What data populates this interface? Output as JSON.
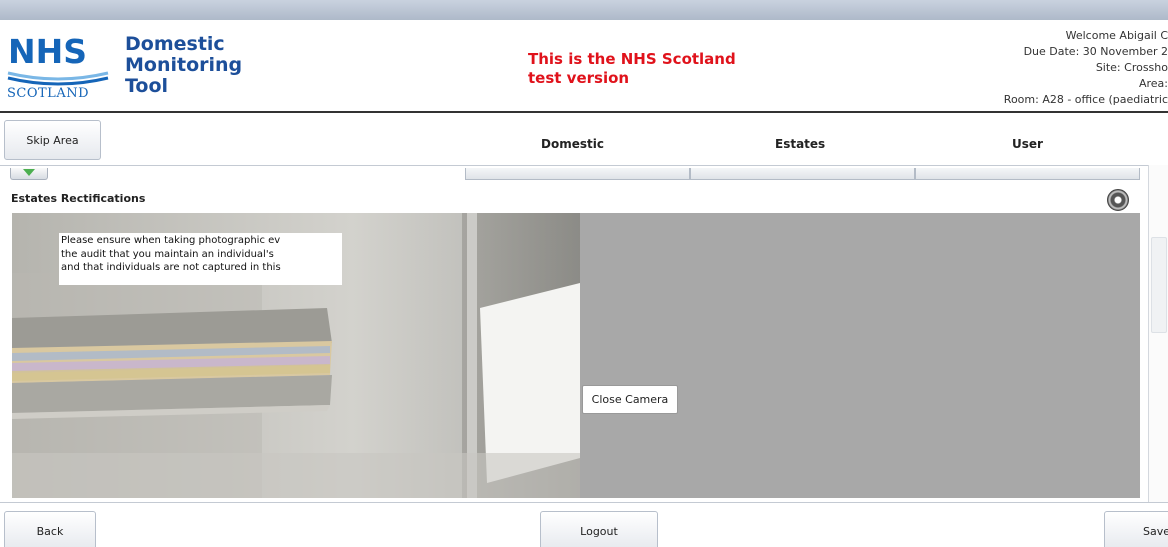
{
  "header": {
    "logo_text": "NHS",
    "logo_subtext": "SCOTLAND",
    "app_title": [
      "Domestic",
      "Monitoring",
      "Tool"
    ],
    "test_version": [
      "This is the NHS Scotland",
      "test version"
    ],
    "user_info": [
      "Welcome Abigail C",
      "Due Date: 30 November 2",
      "Site: Crossho",
      "Area:",
      "Room: A28 - office (paediatric"
    ]
  },
  "nav": {
    "skip_area": "Skip Area",
    "domestic": "Domestic",
    "estates": "Estates",
    "user": "User"
  },
  "section": {
    "title": "Estates Rectifications"
  },
  "camera": {
    "notice_lines": [
      "Please ensure when taking photographic ev",
      "the audit that you maintain an individual's",
      "and that individuals are not captured in this"
    ],
    "close_camera": "Close Camera"
  },
  "footer": {
    "back": "Back",
    "logout": "Logout",
    "save": "Save"
  },
  "colors": {
    "brand_blue": "#1565b8",
    "title_blue": "#1d4f9a",
    "test_red": "#e0121b"
  }
}
